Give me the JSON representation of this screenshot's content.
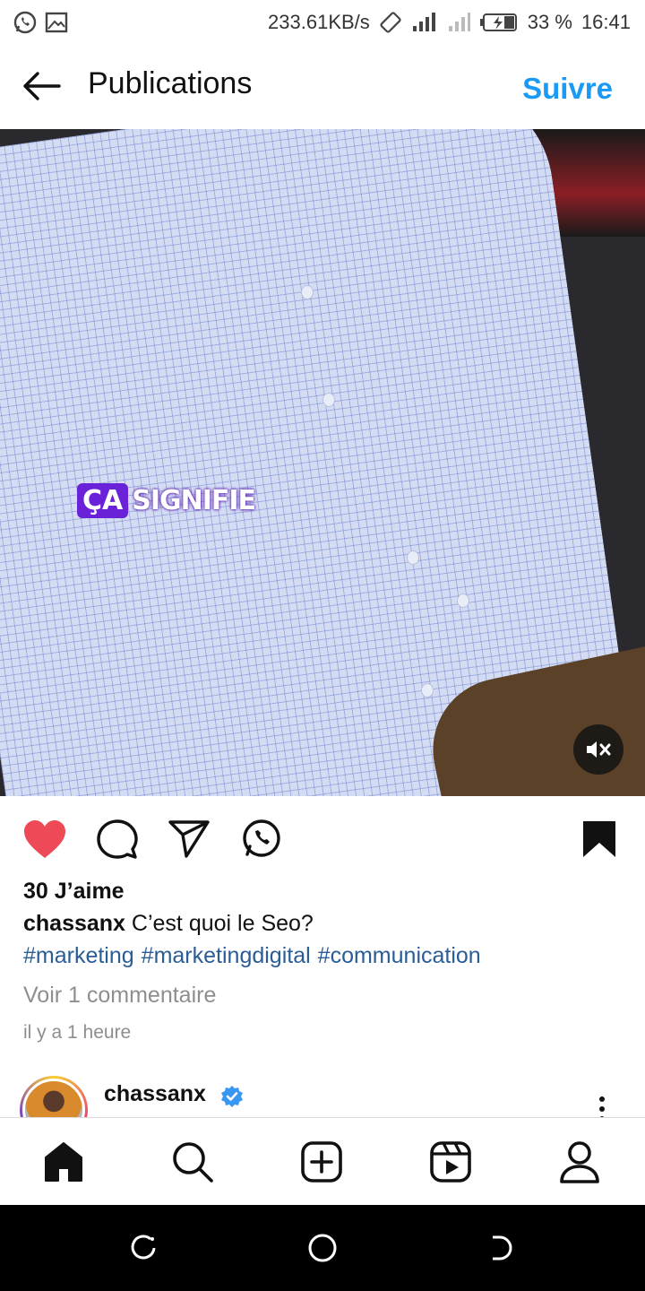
{
  "status_bar": {
    "network_speed": "233.61KB/s",
    "battery": "33 %",
    "time": "16:41",
    "icons": [
      "whatsapp-icon",
      "gallery-icon",
      "rotate-icon",
      "signal-icon",
      "signal-icon",
      "battery-icon"
    ]
  },
  "header": {
    "title": "Publications",
    "follow_label": "Suivre",
    "accent": "#1a9af5"
  },
  "media": {
    "overlay_brand_box": "ÇA",
    "overlay_brand_text": "SIGNIFIE",
    "brand_color": "#6a22d8"
  },
  "post": {
    "likes": "30 J’aime",
    "username": "chassanx",
    "caption": "C’est quoi le Seo?",
    "hashtags": [
      "#marketing",
      "#marketingdigital",
      "#communication"
    ],
    "view_comments": "Voir 1 commentaire",
    "time_ago": "il y a 1 heure",
    "like_color": "#ed4956",
    "hashtag_color": "#2a5d96"
  },
  "next_post": {
    "username": "chassanx"
  },
  "bottom_nav": [
    "home-icon",
    "search-icon",
    "create-icon",
    "reels-icon",
    "profile-icon"
  ]
}
